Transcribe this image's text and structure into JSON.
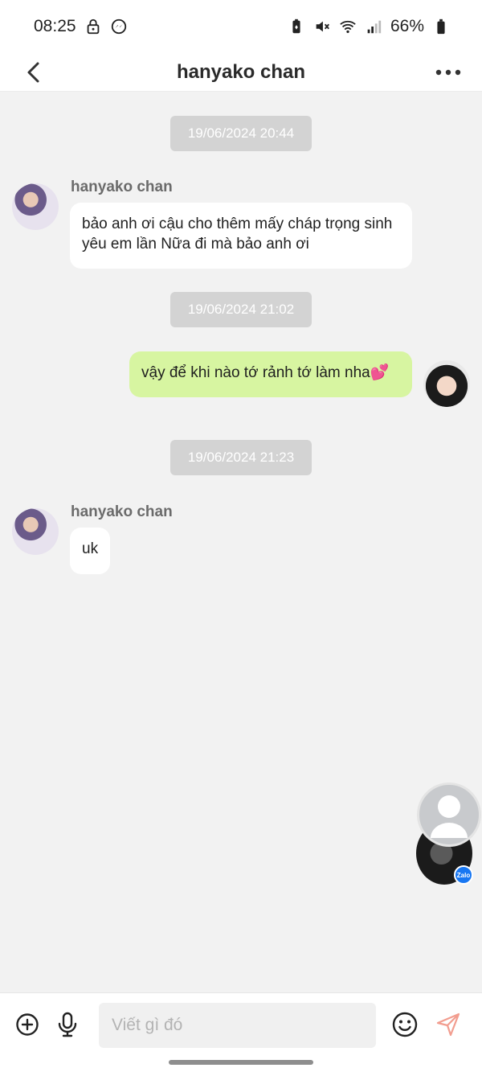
{
  "status_bar": {
    "time": "08:25",
    "battery": "66%",
    "left_icons": [
      "lock-icon",
      "messenger-icon"
    ],
    "right_icons": [
      "battery-saver-icon",
      "mute-icon",
      "wifi-icon",
      "signal-icon",
      "battery-icon"
    ]
  },
  "header": {
    "title": "hanyako chan",
    "back_icon": "chevron-left-icon",
    "more_icon": "more-dots-icon"
  },
  "messages": [
    {
      "type": "timestamp",
      "text": "19/06/2024 20:44"
    },
    {
      "type": "incoming",
      "sender": "hanyako chan",
      "text": "bảo anh ơi cậu cho thêm mấy cháp trọng sinh yêu em lần Nữa đi  mà bảo anh ơi"
    },
    {
      "type": "timestamp",
      "text": "19/06/2024 21:02"
    },
    {
      "type": "outgoing",
      "text": "vậy để khi nào tớ rảnh tớ làm nha💕"
    },
    {
      "type": "timestamp",
      "text": "19/06/2024 21:23"
    },
    {
      "type": "incoming",
      "sender": "hanyako chan",
      "text": "uk"
    }
  ],
  "floating_chat_head": {
    "badge": "Zalo"
  },
  "composer": {
    "placeholder": "Viết gì đó",
    "value": ""
  },
  "colors": {
    "outgoing_bubble": "#d7f5a1",
    "incoming_bubble": "#ffffff",
    "timestamp_bg": "#d3d3d3",
    "send_icon": "#f29d8f"
  }
}
